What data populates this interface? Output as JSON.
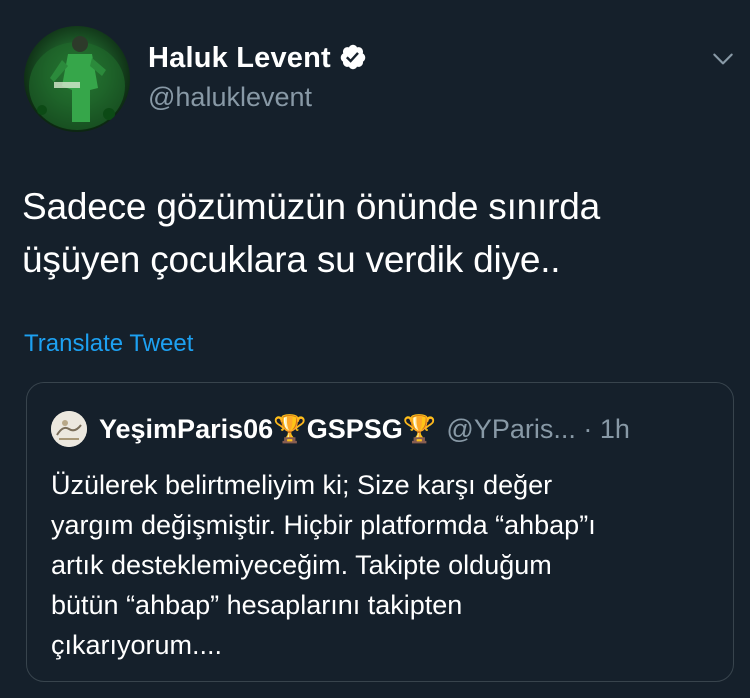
{
  "author": {
    "display_name": "Haluk Levent",
    "handle": "@haluklevent",
    "verified": true
  },
  "tweet": {
    "text_line_1": "Sadece gözümüzün önünde sınırda",
    "text_line_2": "üşüyen çocuklara su verdik diye..",
    "translate_label": "Translate Tweet"
  },
  "quoted_tweet": {
    "display_name": "YeşimParis06🏆GSPSG🏆",
    "handle": "@YParis...",
    "time": " · 1h",
    "text_lines": [
      "Üzülerek belirtmeliyim ki; Size karşı değer",
      "yargım değişmiştir. Hiçbir platformda “ahbap”ı",
      "artık desteklemiyeceğim. Takipte olduğum",
      "bütün “ahbap” hesaplarını takipten",
      "çıkarıyorum...."
    ]
  },
  "icons": {
    "verified": "verified-badge-icon",
    "more": "chevron-down-icon"
  },
  "colors": {
    "background": "#15202b",
    "primary_text": "#ffffff",
    "secondary_text": "#8899a6",
    "link": "#1da1f2",
    "border": "#38444d"
  }
}
